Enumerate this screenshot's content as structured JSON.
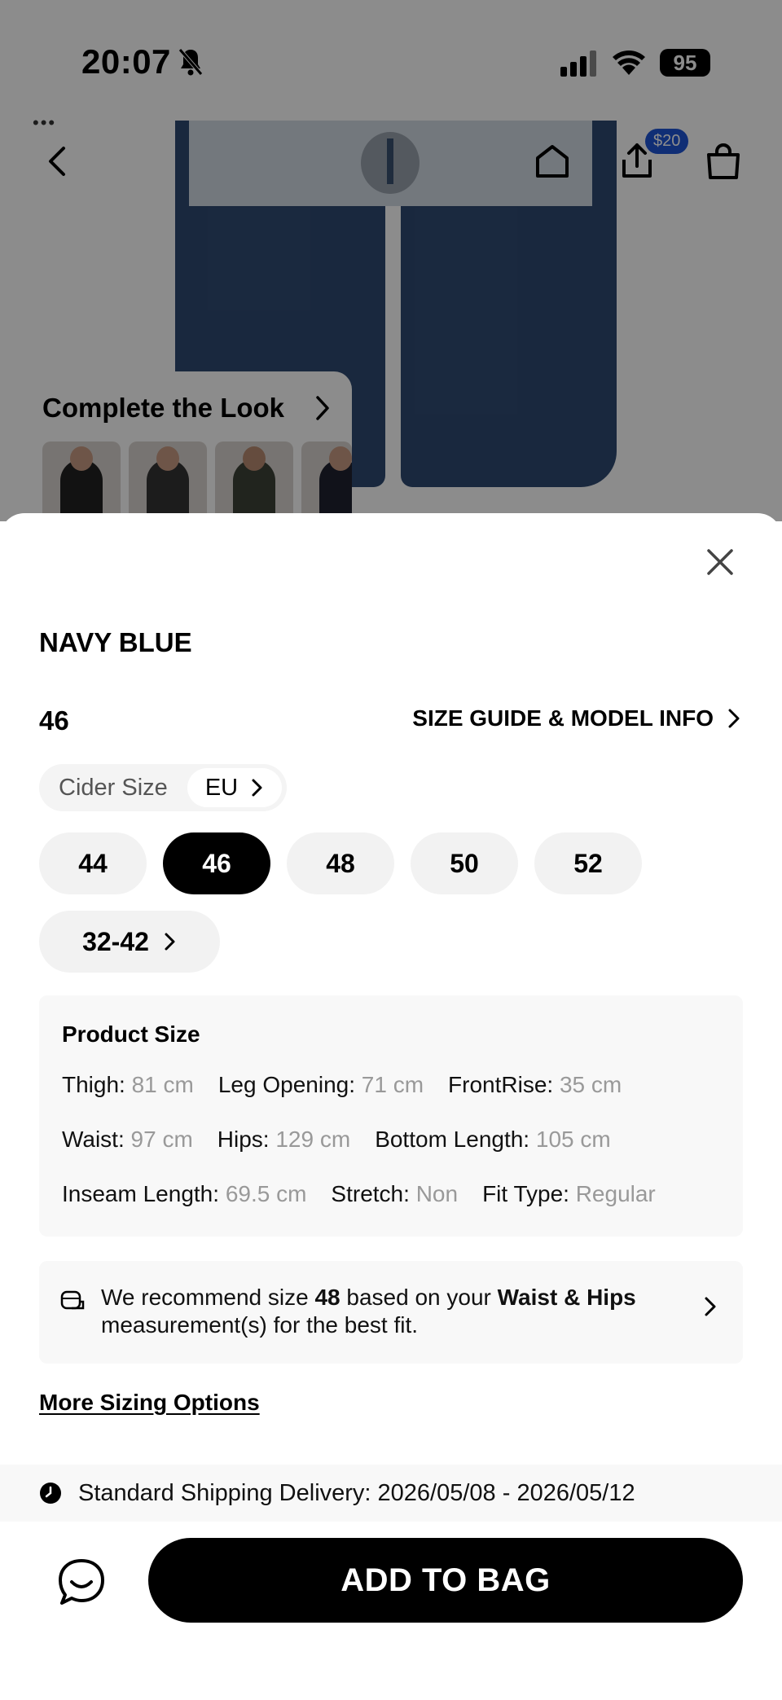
{
  "status_bar": {
    "time": "20:07",
    "battery": "95"
  },
  "header": {
    "badge": "$20"
  },
  "complete_look": {
    "title": "Complete the Look"
  },
  "sheet": {
    "color_name": "NAVY BLUE",
    "selected_size": "46",
    "size_guide_label": "SIZE GUIDE & MODEL INFO",
    "size_system": {
      "label": "Cider Size",
      "value": "EU"
    },
    "sizes": [
      "44",
      "46",
      "48",
      "50",
      "52",
      "32-42"
    ],
    "active_size_index": 1,
    "product_size": {
      "title": "Product Size",
      "rows": [
        [
          {
            "k": "Thigh:",
            "v": "81 cm"
          },
          {
            "k": "Leg Opening:",
            "v": "71 cm"
          },
          {
            "k": "FrontRise:",
            "v": "35 cm"
          }
        ],
        [
          {
            "k": "Waist:",
            "v": "97 cm"
          },
          {
            "k": "Hips:",
            "v": "129 cm"
          },
          {
            "k": "Bottom Length:",
            "v": "105 cm"
          }
        ],
        [
          {
            "k": "Inseam Length:",
            "v": "69.5 cm"
          },
          {
            "k": "Stretch:",
            "v": "Non"
          },
          {
            "k": "Fit Type:",
            "v": "Regular"
          }
        ]
      ]
    },
    "recommendation": {
      "prefix": "We recommend size ",
      "size": "48",
      "middle": " based on your ",
      "basis": "Waist & Hips",
      "suffix": " measurement(s) for the best fit."
    },
    "more_sizing": "More Sizing Options",
    "shipping": "Standard Shipping Delivery: 2026/05/08 - 2026/05/12",
    "add_to_bag": "ADD TO BAG"
  }
}
